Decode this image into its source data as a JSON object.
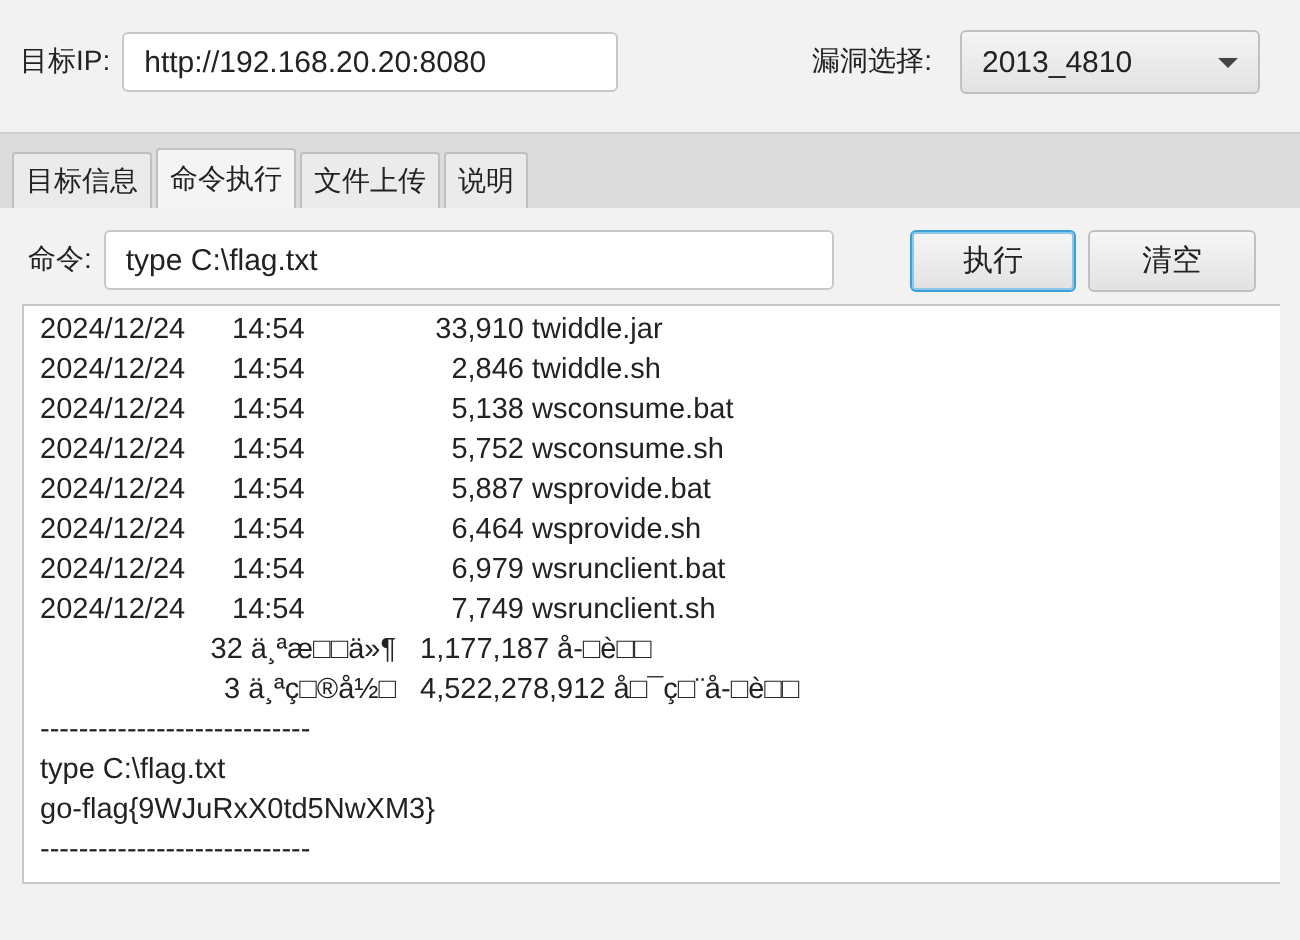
{
  "target": {
    "label": "目标IP:",
    "value": "http://192.168.20.20:8080"
  },
  "vuln_select": {
    "label": "漏洞选择:",
    "value": "2013_4810"
  },
  "tabs": [
    {
      "label": "目标信息",
      "selected": false
    },
    {
      "label": "命令执行",
      "selected": true
    },
    {
      "label": "文件上传",
      "selected": false
    },
    {
      "label": "说明",
      "selected": false
    }
  ],
  "command": {
    "label": "命令:",
    "value": "type C:\\flag.txt"
  },
  "buttons": [
    {
      "label": "执行",
      "focused": true
    },
    {
      "label": "清空",
      "focused": false
    }
  ],
  "output": [
    {
      "kind": "file",
      "date": "2024/12/24",
      "time": "14:54",
      "size": "33,910",
      "name": "twiddle.jar"
    },
    {
      "kind": "file",
      "date": "2024/12/24",
      "time": "14:54",
      "size": "2,846",
      "name": "twiddle.sh"
    },
    {
      "kind": "file",
      "date": "2024/12/24",
      "time": "14:54",
      "size": "5,138",
      "name": "wsconsume.bat"
    },
    {
      "kind": "file",
      "date": "2024/12/24",
      "time": "14:54",
      "size": "5,752",
      "name": "wsconsume.sh"
    },
    {
      "kind": "file",
      "date": "2024/12/24",
      "time": "14:54",
      "size": "5,887",
      "name": "wsprovide.bat"
    },
    {
      "kind": "file",
      "date": "2024/12/24",
      "time": "14:54",
      "size": "6,464",
      "name": "wsprovide.sh"
    },
    {
      "kind": "file",
      "date": "2024/12/24",
      "time": "14:54",
      "size": "6,979",
      "name": "wsrunclient.bat"
    },
    {
      "kind": "file",
      "date": "2024/12/24",
      "time": "14:54",
      "size": "7,749",
      "name": "wsrunclient.sh"
    },
    {
      "kind": "summary",
      "count": "32 ä¸ªæ□□ä»¶",
      "rest": "1,177,187 å-□è□□"
    },
    {
      "kind": "summary",
      "count": "3 ä¸ªç□®å½□",
      "rest": "4,522,278,912 å□¯ç□¨å-□è□□"
    },
    {
      "kind": "text",
      "text": "----------------------------"
    },
    {
      "kind": "text",
      "text": "type C:\\flag.txt"
    },
    {
      "kind": "text",
      "text": "go-flag{9WJuRxX0td5NwXM3}"
    },
    {
      "kind": "text",
      "text": "----------------------------"
    }
  ]
}
